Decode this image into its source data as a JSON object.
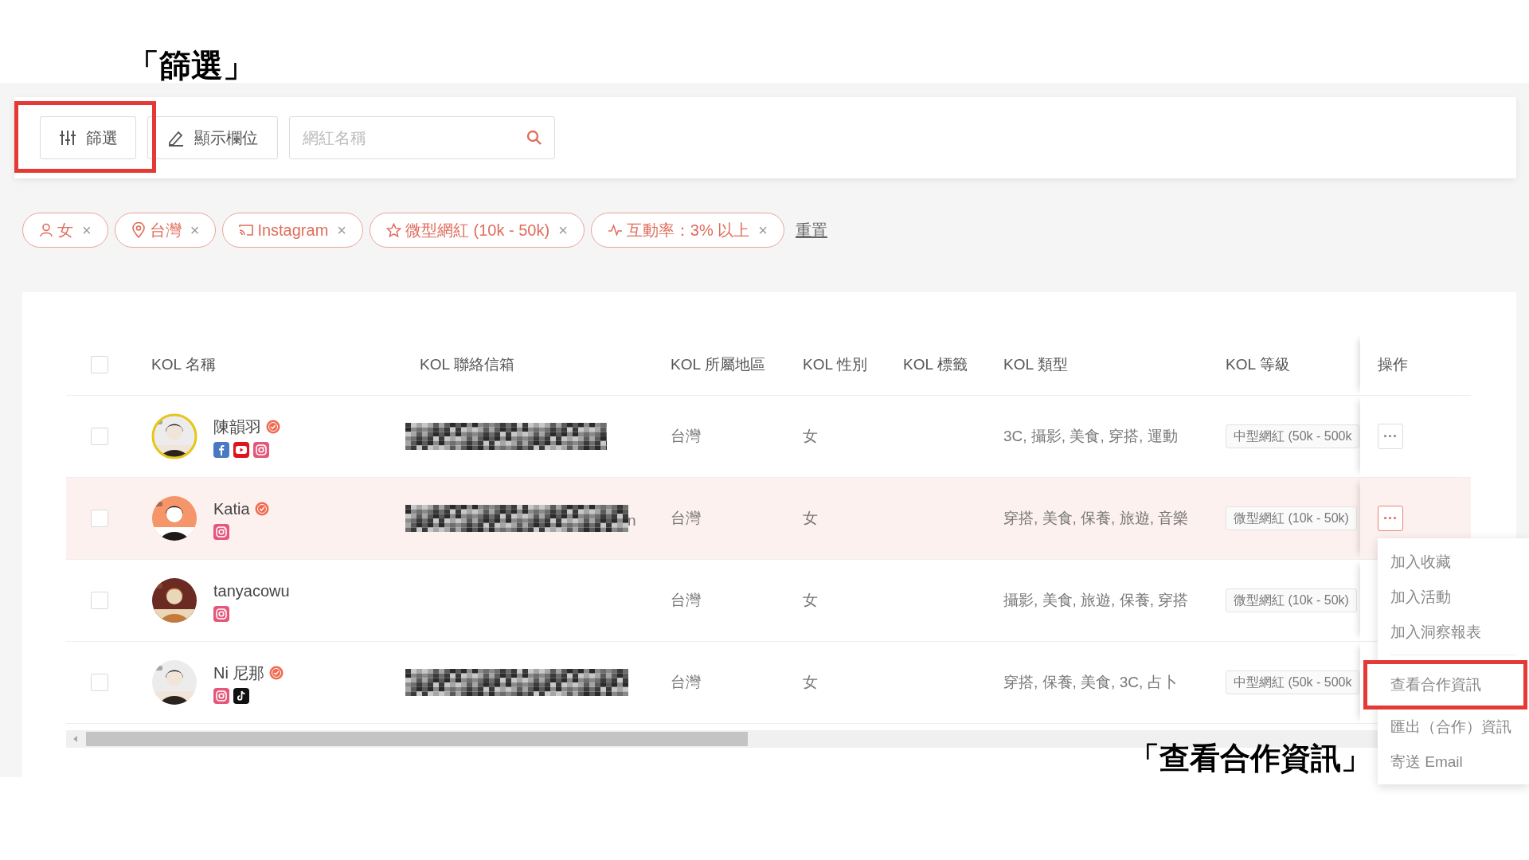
{
  "filter_callout": "「篩選」",
  "menu_callout": "「查看合作資訊」",
  "toolbar": {
    "filter_button": {
      "label": "篩選",
      "highlighted": true
    },
    "columns_button": {
      "label": "顯示欄位"
    },
    "search": {
      "placeholder": "網紅名稱"
    }
  },
  "filters": [
    {
      "kind": "person",
      "label": "女",
      "remove": "×"
    },
    {
      "kind": "pin",
      "label": "台灣",
      "remove": "×"
    },
    {
      "kind": "cast",
      "label": "Instagram",
      "remove": "×"
    },
    {
      "kind": "star",
      "label": "微型網紅 (10k - 50k)",
      "remove": "×"
    },
    {
      "kind": "pulse",
      "label": "互動率：3% 以上",
      "remove": "×"
    }
  ],
  "reset_link": "重置",
  "table": {
    "header_checked": false,
    "columns": [
      "KOL 名稱",
      "KOL 聯絡信箱",
      "KOL 所屬地區",
      "KOL 性別",
      "KOL 標籤",
      "KOL 類型",
      "KOL 等級",
      "操作"
    ],
    "rows": [
      {
        "checked": false,
        "hovered": false,
        "avatar": {
          "kind": "picture",
          "ring": true
        },
        "name": "陳韻羽",
        "verified": true,
        "platforms": [
          {
            "kind": "facebook"
          },
          {
            "kind": "youtube"
          },
          {
            "kind": "instagram"
          }
        ],
        "email": {
          "kind": "redacted"
        },
        "region": "台灣",
        "gender": "女",
        "type": "3C, 攝影, 美食, 穿搭, 運動",
        "level": "中型網紅 (50k - 500k",
        "action": "···"
      },
      {
        "checked": false,
        "hovered": true,
        "avatar": {
          "kind": "picture",
          "ring": false
        },
        "name": "Katia",
        "verified": true,
        "platforms": [
          {
            "kind": "instagram"
          }
        ],
        "email": {
          "kind": "redacted",
          "tail": "n"
        },
        "region": "台灣",
        "gender": "女",
        "type": "穿搭, 美食, 保養, 旅遊, 音樂",
        "level": "微型網紅 (10k - 50k)",
        "action": "···"
      },
      {
        "checked": false,
        "hovered": false,
        "avatar": {
          "kind": "picture",
          "ring": false
        },
        "name": "tanyacowu",
        "verified": false,
        "platforms": [
          {
            "kind": "instagram"
          }
        ],
        "region": "台灣",
        "gender": "女",
        "type": "攝影, 美食, 旅遊, 保養, 穿搭",
        "level": "微型網紅 (10k - 50k)"
      },
      {
        "checked": false,
        "hovered": false,
        "avatar": {
          "kind": "picture",
          "ring": false
        },
        "name": "Ni 尼那",
        "verified": true,
        "platforms": [
          {
            "kind": "instagram"
          },
          {
            "kind": "tiktok"
          }
        ],
        "email": {
          "kind": "redacted"
        },
        "region": "台灣",
        "gender": "女",
        "type": "穿搭, 保養, 美食, 3C, 占卜",
        "level": "中型網紅 (50k - 500k"
      }
    ]
  },
  "action_menu": {
    "items": [
      {
        "label": "加入收藏",
        "highlighted": false
      },
      {
        "label": "加入活動",
        "highlighted": false
      },
      {
        "label": "加入洞察報表",
        "highlighted": false
      },
      {
        "label": "查看合作資訊",
        "highlighted": true
      },
      {
        "label": "匯出（合作）資訊",
        "highlighted": false
      },
      {
        "label": "寄送 Email",
        "highlighted": false
      }
    ]
  }
}
